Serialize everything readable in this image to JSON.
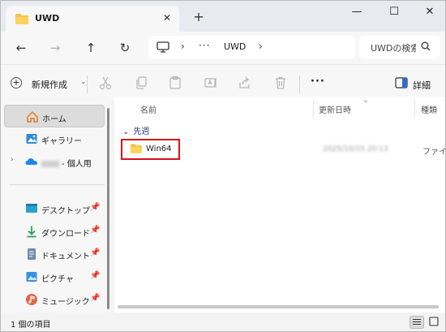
{
  "window": {
    "tab_title": "UWD",
    "new_tab": "+",
    "minimize": "—",
    "maximize": "☐",
    "close": "✕"
  },
  "address": {
    "crumbs": [
      "UWD"
    ],
    "search_placeholder": "UWDの検索"
  },
  "commands": {
    "new_label": "新規作成",
    "more": "···",
    "details_label": "詳細"
  },
  "sidebar": {
    "items": [
      {
        "label": "ホーム",
        "icon": "home-icon",
        "selected": true
      },
      {
        "label": "ギャラリー",
        "icon": "gallery-icon"
      },
      {
        "label": "- 個人用",
        "icon": "onedrive-icon",
        "expandable": true
      },
      {
        "label": "デスクトップ",
        "icon": "desktop-icon",
        "pinned": true
      },
      {
        "label": "ダウンロード",
        "icon": "download-icon",
        "pinned": true
      },
      {
        "label": "ドキュメント",
        "icon": "documents-icon",
        "pinned": true
      },
      {
        "label": "ピクチャ",
        "icon": "pictures-icon",
        "pinned": true
      },
      {
        "label": "ミュージック",
        "icon": "music-icon",
        "pinned": true
      }
    ]
  },
  "columns": {
    "name": "名前",
    "modified": "更新日時",
    "type": "種類"
  },
  "group": {
    "label": "先週"
  },
  "files": [
    {
      "name": "Win64",
      "modified": "2025/10/15 20:13",
      "type": "ファイル"
    }
  ],
  "status": {
    "count": "1 個の項目"
  },
  "colors": {
    "accent_folder": "#f6c244",
    "highlight_border": "#d6111b",
    "group_text": "#2b3a7a"
  }
}
